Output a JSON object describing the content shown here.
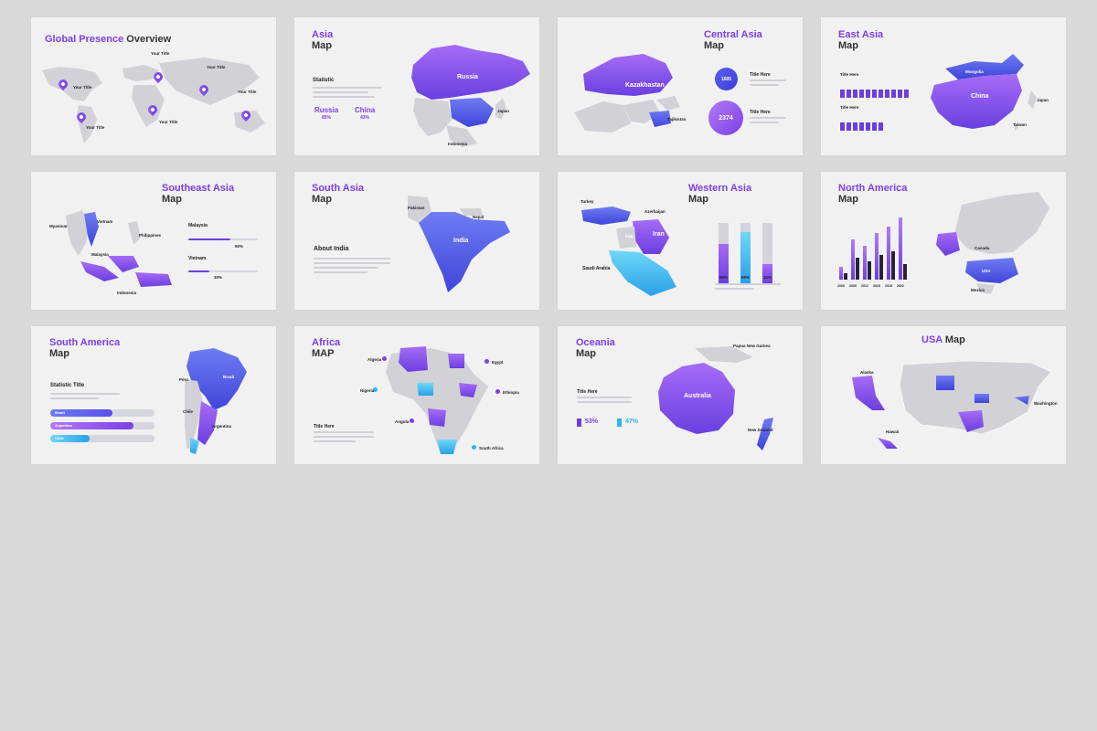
{
  "colors": {
    "purple": "#7b3fe4",
    "violet": "#9b5cf0",
    "blue": "#4a6ee8",
    "cyan": "#2ab7e8",
    "dark": "#2a2233",
    "map": "#d2d2d6",
    "background": "#d9d9d9"
  },
  "slides": {
    "global": {
      "title_a": "Global Presence",
      "title_b": "Overview",
      "pin_label": "Your Title"
    },
    "asia": {
      "title": "Asia",
      "subtitle": "Map",
      "stat_label": "Statistic",
      "stat1_name": "Russia",
      "stat1_value": "85%",
      "stat2_name": "China",
      "stat2_value": "43%",
      "map_label_russia": "Russia",
      "map_label_japan": "Japan",
      "map_label_indonesia": "Indonesia"
    },
    "central_asia": {
      "title": "Central Asia",
      "subtitle": "Map",
      "map_label": "Kazakhastan",
      "map_label_tajik": "Tajikistan",
      "title_here_1": "Title Here",
      "title_here_2": "Title Here",
      "circle1": "1605",
      "circle2": "2374"
    },
    "east_asia": {
      "title": "East Asia",
      "subtitle": "Map",
      "map_label_china": "China",
      "map_label_mongolia": "Mongolia",
      "map_label_japan": "Japan",
      "map_label_taiwan": "Taiwan",
      "title_here_1": "Title Here",
      "title_here_2": "Title Here"
    },
    "southeast_asia": {
      "title": "Southeast Asia",
      "subtitle": "Map",
      "map_label_myanmar": "Myanmar",
      "map_label_vietnam": "Vietnam",
      "map_label_philippines": "Philippines",
      "map_label_malaysia": "Malaysia",
      "map_label_indonesia": "Indonesia",
      "stat1_name": "Malaysia",
      "stat1_value": "60%",
      "stat1_fraction": 0.6,
      "stat2_name": "Vietnam",
      "stat2_value": "30%",
      "stat2_fraction": 0.3
    },
    "south_asia": {
      "title": "South Asia",
      "subtitle": "Map",
      "map_label_india": "India",
      "map_label_pakistan": "Pakistan",
      "map_label_nepal": "Nepal",
      "about": "About India"
    },
    "western_asia": {
      "title": "Western Asia",
      "subtitle": "Map",
      "map_label_turkey": "Turkey",
      "map_label_iran": "Iran",
      "map_label_iraq": "Iraq",
      "map_label_saudi": "Saudi Arabia",
      "map_label_azerbaijan": "Azerbaijan",
      "bars": [
        {
          "value": "65%",
          "fraction": 0.65
        },
        {
          "value": "85%",
          "fraction": 0.85
        },
        {
          "value": "32%",
          "fraction": 0.32
        }
      ]
    },
    "north_america": {
      "title": "North America",
      "subtitle": "Map",
      "map_label_canada": "Canada",
      "map_label_usa": "USA",
      "map_label_mexico": "Mexico",
      "years": [
        "2005",
        "2009",
        "2012",
        "2015",
        "2018",
        "2022"
      ],
      "series_purple": [
        0.2,
        0.65,
        0.55,
        0.75,
        0.85,
        1.0
      ],
      "series_dark": [
        0.1,
        0.35,
        0.3,
        0.4,
        0.45,
        0.25
      ]
    },
    "south_america": {
      "title": "South America",
      "subtitle": "Map",
      "stat_title": "Statistic Title",
      "map_label_peru": "Peru",
      "map_label_brazil": "Brazil",
      "map_label_chile": "Chile",
      "map_label_argentina": "Argentina",
      "bars": [
        {
          "name": "Brazil",
          "fraction": 0.6
        },
        {
          "name": "Argentina",
          "fraction": 0.8
        },
        {
          "name": "Chile",
          "fraction": 0.38
        }
      ]
    },
    "africa": {
      "title": "Africa",
      "subtitle": "MAP",
      "title_here": "Title Here",
      "map_label_algeria": "Algeria",
      "map_label_egypt": "Egypt",
      "map_label_nigeria": "Nigeria",
      "map_label_ethiopia": "Ethiopia",
      "map_label_angola": "Angola",
      "map_label_south_africa": "South Africa"
    },
    "oceania": {
      "title": "Oceania",
      "subtitle": "Map",
      "title_here": "Title Here",
      "map_label_australia": "Australia",
      "map_label_png": "Papua New Guinea",
      "map_label_nz": "New Zealand",
      "stat1": "53%",
      "stat2": "47%"
    },
    "usa": {
      "title_a": "USA",
      "title_b": "Map",
      "map_label_alaska": "Alaska",
      "map_label_hawaii": "Hawaii",
      "map_label_washington": "Washington"
    }
  }
}
